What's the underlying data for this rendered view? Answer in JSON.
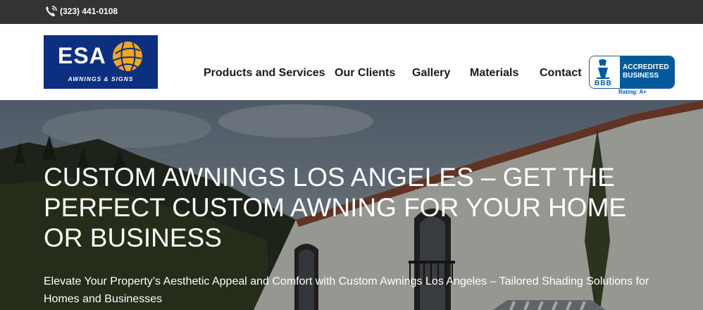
{
  "topbar": {
    "phone": "(323) 441-0108",
    "phone_icon": "phone-icon"
  },
  "logo": {
    "name": "ESA",
    "tagline": "AWNINGS & SIGNS",
    "emblem_icon": "esa-ball-icon",
    "background_color": "#0d2f7f",
    "emblem_color": "#f5a623"
  },
  "nav": {
    "items": [
      {
        "label": "Products and Services"
      },
      {
        "label": "Our Clients"
      },
      {
        "label": "Gallery"
      },
      {
        "label": "Materials"
      },
      {
        "label": "Contact"
      }
    ]
  },
  "bbb": {
    "logo_text": "BBB",
    "line1": "ACCREDITED",
    "line2": "BUSINESS",
    "rating": "Rating: A+",
    "color": "#005a9c",
    "icon": "bbb-torch-icon"
  },
  "hero": {
    "title": "CUSTOM AWNINGS LOS ANGELES – GET THE PERFECT CUSTOM AWNING FOR YOUR HOME OR BUSINESS",
    "subtitle": "Elevate Your Property’s Aesthetic Appeal and Comfort with Custom Awnings Los Angeles – Tailored Shading Solutions for Homes and Businesses"
  },
  "colors": {
    "topbar": "#333333",
    "nav_text": "#1a1a1a"
  }
}
